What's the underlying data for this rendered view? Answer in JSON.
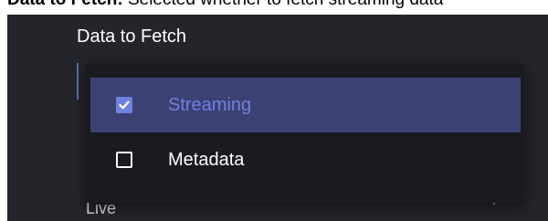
{
  "caption": {
    "bold": "Data to Fetch:",
    "rest": " Selected whether to fetch streaming data"
  },
  "field": {
    "label": "Data to Fetch"
  },
  "menu": {
    "options": [
      {
        "label": "Streaming",
        "checked": true
      },
      {
        "label": "Metadata",
        "checked": false
      }
    ]
  },
  "next_field": {
    "label": "Live"
  },
  "colors": {
    "background": "#24252b",
    "menu_bg": "#1a1b20",
    "selected_bg": "#3c4173",
    "accent": "#6f81e0"
  },
  "icons": {
    "checked": "checkbox-checked-icon",
    "unchecked": "checkbox-unchecked-icon",
    "dropdown": "chevron-down-icon"
  }
}
